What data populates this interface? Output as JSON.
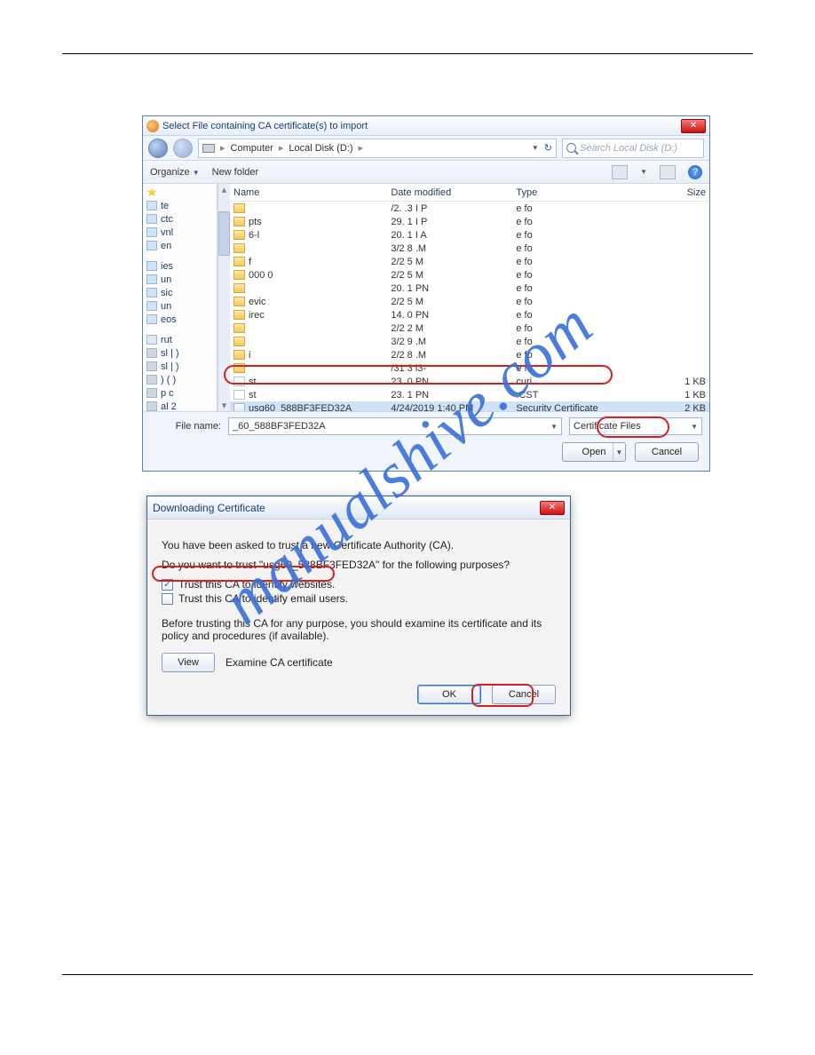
{
  "watermark": "manualshive.com",
  "file_dialog": {
    "title": "Select File containing CA certificate(s) to import",
    "breadcrumb": {
      "root": "Computer",
      "drive": "Local Disk (D:)"
    },
    "search_placeholder": "Search Local Disk (D:)",
    "toolbar": {
      "organize": "Organize",
      "new_folder": "New folder"
    },
    "columns": {
      "name": "Name",
      "date": "Date modified",
      "type": "Type",
      "size": "Size"
    },
    "tree": {
      "favorites": [
        "te",
        "ctc",
        "vnl",
        "en"
      ],
      "libraries_label": "ies",
      "libraries": [
        "un",
        "sic",
        "un",
        "eos"
      ],
      "computer": [
        "rut",
        "sl |   )",
        "sl |   )",
        ") (   )",
        "p    c",
        "al   2"
      ]
    },
    "rows": [
      {
        "icon": "folder",
        "name": "",
        "date": "/2.   .3   I P",
        "type": "e fo",
        "size": ""
      },
      {
        "icon": "folder",
        "name": "pts",
        "date": "29.   1   I P",
        "type": "e fo",
        "size": ""
      },
      {
        "icon": "folder",
        "name": "6-l",
        "date": "20.   1   I A",
        "type": "e fo",
        "size": ""
      },
      {
        "icon": "folder",
        "name": "",
        "date": "3/2   8   .M",
        "type": "e fo",
        "size": ""
      },
      {
        "icon": "folder",
        "name": "f",
        "date": "2/2   5   M",
        "type": "e fo",
        "size": ""
      },
      {
        "icon": "folder",
        "name": "000       0",
        "date": "2/2   5   M",
        "type": "e fo",
        "size": ""
      },
      {
        "icon": "folder",
        "name": "",
        "date": "20.   1   PN",
        "type": "e fo",
        "size": ""
      },
      {
        "icon": "folder",
        "name": "evic",
        "date": "2/2   5   M",
        "type": "e fo",
        "size": ""
      },
      {
        "icon": "folder",
        "name": "irec",
        "date": "14.   0   PN",
        "type": "e fo",
        "size": ""
      },
      {
        "icon": "folder",
        "name": "",
        "date": "2/2   2   M",
        "type": "e fo",
        "size": ""
      },
      {
        "icon": "folder",
        "name": "",
        "date": "3/2   9   .M",
        "type": "e fo",
        "size": ""
      },
      {
        "icon": "folder",
        "name": "i",
        "date": "2/2   8   .M",
        "type": "e fo",
        "size": ""
      },
      {
        "icon": "folder",
        "name": "",
        "date": "/31   3   i3-",
        "type": "e fo",
        "size": ""
      },
      {
        "icon": "file",
        "name": "st",
        "date": "23.   0   PN",
        "type": "curi",
        "size": "1 KB"
      },
      {
        "icon": "file",
        "name": "st",
        "date": "23.   1   PN",
        "type": ".CST",
        "size": "1 KB"
      },
      {
        "icon": "cert",
        "name": "usg60_588BF3FED32A",
        "date": "4/24/2019 1:40 PM",
        "type": "Security Certificate",
        "size": "2 KB",
        "selected": true
      }
    ],
    "filename_label": "File name:",
    "filename_value": "_60_588BF3FED32A",
    "filter_label": "Certificate Files",
    "open": "Open",
    "cancel": "Cancel"
  },
  "cert_dialog": {
    "title": "Downloading Certificate",
    "line1": "You have been asked to trust a new Certificate Authority (CA).",
    "line2": "Do you want to trust \"usg60_588BF3FED32A\" for the following purposes?",
    "opt_web": "Trust this CA to identify websites.",
    "opt_email": "Trust this CA to identify email users.",
    "note": "Before trusting this CA for any purpose, you should examine its certificate and its policy and procedures (if available).",
    "view": "View",
    "examine": "Examine CA certificate",
    "ok": "OK",
    "cancel": "Cancel"
  }
}
